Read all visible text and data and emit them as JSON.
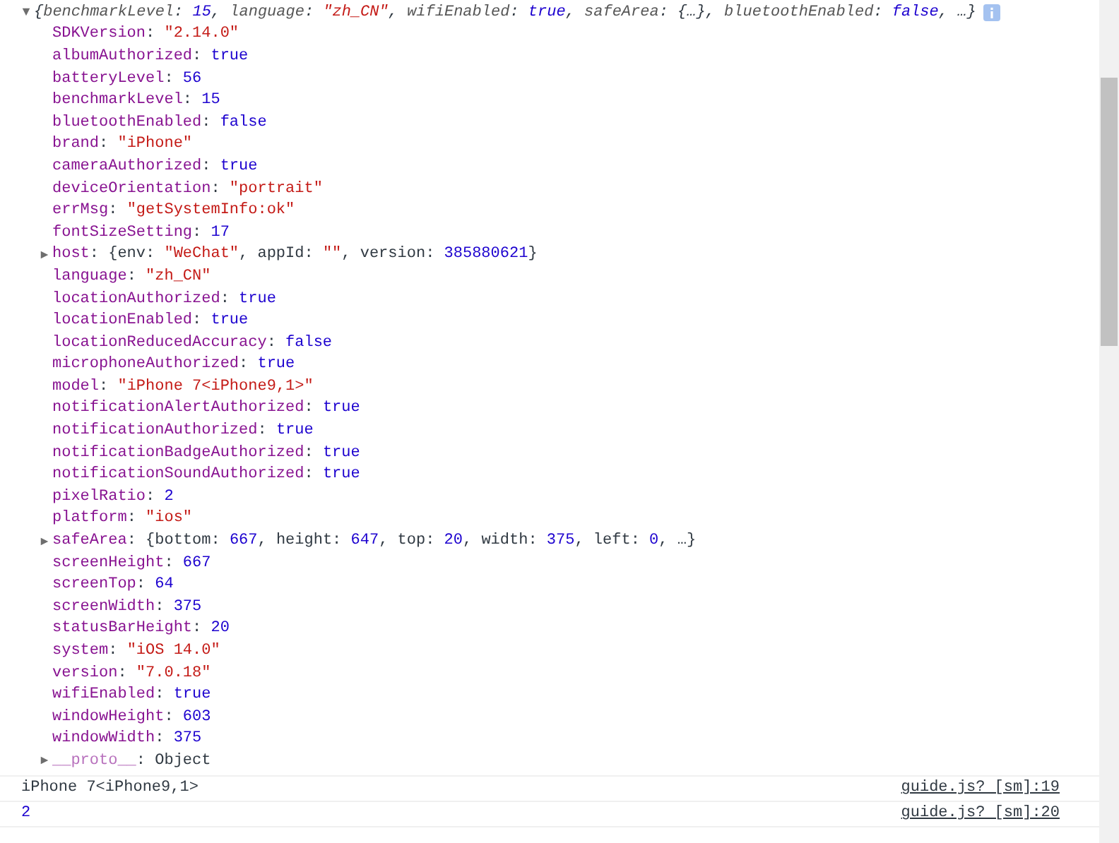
{
  "object_tree": {
    "expanded": true,
    "summary": [
      {
        "t": "{",
        "kind": "punct"
      },
      {
        "t": "benchmarkLevel",
        "kind": "key"
      },
      {
        "t": ": ",
        "kind": "punct"
      },
      {
        "t": "15",
        "kind": "number"
      },
      {
        "t": ", ",
        "kind": "punct"
      },
      {
        "t": "language",
        "kind": "key"
      },
      {
        "t": ": ",
        "kind": "punct"
      },
      {
        "t": "\"zh_CN\"",
        "kind": "string"
      },
      {
        "t": ", ",
        "kind": "punct"
      },
      {
        "t": "wifiEnabled",
        "kind": "key"
      },
      {
        "t": ": ",
        "kind": "punct"
      },
      {
        "t": "true",
        "kind": "number"
      },
      {
        "t": ", ",
        "kind": "punct"
      },
      {
        "t": "safeArea",
        "kind": "key"
      },
      {
        "t": ": {…}, ",
        "kind": "punct"
      },
      {
        "t": "bluetoothEnabled",
        "kind": "key"
      },
      {
        "t": ": ",
        "kind": "punct"
      },
      {
        "t": "false",
        "kind": "number"
      },
      {
        "t": ", …}",
        "kind": "punct"
      }
    ],
    "properties": [
      {
        "kind": "leaf",
        "tokens": [
          {
            "t": "SDKVersion",
            "kind": "key"
          },
          {
            "t": ": ",
            "kind": "punct"
          },
          {
            "t": "\"2.14.0\"",
            "kind": "string"
          }
        ]
      },
      {
        "kind": "leaf",
        "tokens": [
          {
            "t": "albumAuthorized",
            "kind": "key"
          },
          {
            "t": ": ",
            "kind": "punct"
          },
          {
            "t": "true",
            "kind": "number"
          }
        ]
      },
      {
        "kind": "leaf",
        "tokens": [
          {
            "t": "batteryLevel",
            "kind": "key"
          },
          {
            "t": ": ",
            "kind": "punct"
          },
          {
            "t": "56",
            "kind": "number"
          }
        ]
      },
      {
        "kind": "leaf",
        "tokens": [
          {
            "t": "benchmarkLevel",
            "kind": "key"
          },
          {
            "t": ": ",
            "kind": "punct"
          },
          {
            "t": "15",
            "kind": "number"
          }
        ]
      },
      {
        "kind": "leaf",
        "tokens": [
          {
            "t": "bluetoothEnabled",
            "kind": "key"
          },
          {
            "t": ": ",
            "kind": "punct"
          },
          {
            "t": "false",
            "kind": "number"
          }
        ]
      },
      {
        "kind": "leaf",
        "tokens": [
          {
            "t": "brand",
            "kind": "key"
          },
          {
            "t": ": ",
            "kind": "punct"
          },
          {
            "t": "\"iPhone\"",
            "kind": "string"
          }
        ]
      },
      {
        "kind": "leaf",
        "tokens": [
          {
            "t": "cameraAuthorized",
            "kind": "key"
          },
          {
            "t": ": ",
            "kind": "punct"
          },
          {
            "t": "true",
            "kind": "number"
          }
        ]
      },
      {
        "kind": "leaf",
        "tokens": [
          {
            "t": "deviceOrientation",
            "kind": "key"
          },
          {
            "t": ": ",
            "kind": "punct"
          },
          {
            "t": "\"portrait\"",
            "kind": "string"
          }
        ]
      },
      {
        "kind": "leaf",
        "tokens": [
          {
            "t": "errMsg",
            "kind": "key"
          },
          {
            "t": ": ",
            "kind": "punct"
          },
          {
            "t": "\"getSystemInfo:ok\"",
            "kind": "string"
          }
        ]
      },
      {
        "kind": "leaf",
        "tokens": [
          {
            "t": "fontSizeSetting",
            "kind": "key"
          },
          {
            "t": ": ",
            "kind": "punct"
          },
          {
            "t": "17",
            "kind": "number"
          }
        ]
      },
      {
        "kind": "toggle",
        "expanded": false,
        "tokens": [
          {
            "t": "host",
            "kind": "key"
          },
          {
            "t": ": {env: ",
            "kind": "punct"
          },
          {
            "t": "\"WeChat\"",
            "kind": "string"
          },
          {
            "t": ", appId: ",
            "kind": "punct"
          },
          {
            "t": "\"\"",
            "kind": "string"
          },
          {
            "t": ", version: ",
            "kind": "punct"
          },
          {
            "t": "385880621",
            "kind": "number"
          },
          {
            "t": "}",
            "kind": "punct"
          }
        ]
      },
      {
        "kind": "leaf",
        "tokens": [
          {
            "t": "language",
            "kind": "key"
          },
          {
            "t": ": ",
            "kind": "punct"
          },
          {
            "t": "\"zh_CN\"",
            "kind": "string"
          }
        ]
      },
      {
        "kind": "leaf",
        "tokens": [
          {
            "t": "locationAuthorized",
            "kind": "key"
          },
          {
            "t": ": ",
            "kind": "punct"
          },
          {
            "t": "true",
            "kind": "number"
          }
        ]
      },
      {
        "kind": "leaf",
        "tokens": [
          {
            "t": "locationEnabled",
            "kind": "key"
          },
          {
            "t": ": ",
            "kind": "punct"
          },
          {
            "t": "true",
            "kind": "number"
          }
        ]
      },
      {
        "kind": "leaf",
        "tokens": [
          {
            "t": "locationReducedAccuracy",
            "kind": "key"
          },
          {
            "t": ": ",
            "kind": "punct"
          },
          {
            "t": "false",
            "kind": "number"
          }
        ]
      },
      {
        "kind": "leaf",
        "tokens": [
          {
            "t": "microphoneAuthorized",
            "kind": "key"
          },
          {
            "t": ": ",
            "kind": "punct"
          },
          {
            "t": "true",
            "kind": "number"
          }
        ]
      },
      {
        "kind": "leaf",
        "tokens": [
          {
            "t": "model",
            "kind": "key"
          },
          {
            "t": ": ",
            "kind": "punct"
          },
          {
            "t": "\"iPhone 7<iPhone9,1>\"",
            "kind": "string"
          }
        ]
      },
      {
        "kind": "leaf",
        "tokens": [
          {
            "t": "notificationAlertAuthorized",
            "kind": "key"
          },
          {
            "t": ": ",
            "kind": "punct"
          },
          {
            "t": "true",
            "kind": "number"
          }
        ]
      },
      {
        "kind": "leaf",
        "tokens": [
          {
            "t": "notificationAuthorized",
            "kind": "key"
          },
          {
            "t": ": ",
            "kind": "punct"
          },
          {
            "t": "true",
            "kind": "number"
          }
        ]
      },
      {
        "kind": "leaf",
        "tokens": [
          {
            "t": "notificationBadgeAuthorized",
            "kind": "key"
          },
          {
            "t": ": ",
            "kind": "punct"
          },
          {
            "t": "true",
            "kind": "number"
          }
        ]
      },
      {
        "kind": "leaf",
        "tokens": [
          {
            "t": "notificationSoundAuthorized",
            "kind": "key"
          },
          {
            "t": ": ",
            "kind": "punct"
          },
          {
            "t": "true",
            "kind": "number"
          }
        ]
      },
      {
        "kind": "leaf",
        "tokens": [
          {
            "t": "pixelRatio",
            "kind": "key"
          },
          {
            "t": ": ",
            "kind": "punct"
          },
          {
            "t": "2",
            "kind": "number"
          }
        ]
      },
      {
        "kind": "leaf",
        "tokens": [
          {
            "t": "platform",
            "kind": "key"
          },
          {
            "t": ": ",
            "kind": "punct"
          },
          {
            "t": "\"ios\"",
            "kind": "string"
          }
        ]
      },
      {
        "kind": "toggle",
        "expanded": false,
        "tokens": [
          {
            "t": "safeArea",
            "kind": "key"
          },
          {
            "t": ": {bottom: ",
            "kind": "punct"
          },
          {
            "t": "667",
            "kind": "number"
          },
          {
            "t": ", height: ",
            "kind": "punct"
          },
          {
            "t": "647",
            "kind": "number"
          },
          {
            "t": ", top: ",
            "kind": "punct"
          },
          {
            "t": "20",
            "kind": "number"
          },
          {
            "t": ", width: ",
            "kind": "punct"
          },
          {
            "t": "375",
            "kind": "number"
          },
          {
            "t": ", left: ",
            "kind": "punct"
          },
          {
            "t": "0",
            "kind": "number"
          },
          {
            "t": ", …}",
            "kind": "punct"
          }
        ]
      },
      {
        "kind": "leaf",
        "tokens": [
          {
            "t": "screenHeight",
            "kind": "key"
          },
          {
            "t": ": ",
            "kind": "punct"
          },
          {
            "t": "667",
            "kind": "number"
          }
        ]
      },
      {
        "kind": "leaf",
        "tokens": [
          {
            "t": "screenTop",
            "kind": "key"
          },
          {
            "t": ": ",
            "kind": "punct"
          },
          {
            "t": "64",
            "kind": "number"
          }
        ]
      },
      {
        "kind": "leaf",
        "tokens": [
          {
            "t": "screenWidth",
            "kind": "key"
          },
          {
            "t": ": ",
            "kind": "punct"
          },
          {
            "t": "375",
            "kind": "number"
          }
        ]
      },
      {
        "kind": "leaf",
        "tokens": [
          {
            "t": "statusBarHeight",
            "kind": "key"
          },
          {
            "t": ": ",
            "kind": "punct"
          },
          {
            "t": "20",
            "kind": "number"
          }
        ]
      },
      {
        "kind": "leaf",
        "tokens": [
          {
            "t": "system",
            "kind": "key"
          },
          {
            "t": ": ",
            "kind": "punct"
          },
          {
            "t": "\"iOS 14.0\"",
            "kind": "string"
          }
        ]
      },
      {
        "kind": "leaf",
        "tokens": [
          {
            "t": "version",
            "kind": "key"
          },
          {
            "t": ": ",
            "kind": "punct"
          },
          {
            "t": "\"7.0.18\"",
            "kind": "string"
          }
        ]
      },
      {
        "kind": "leaf",
        "tokens": [
          {
            "t": "wifiEnabled",
            "kind": "key"
          },
          {
            "t": ": ",
            "kind": "punct"
          },
          {
            "t": "true",
            "kind": "number"
          }
        ]
      },
      {
        "kind": "leaf",
        "tokens": [
          {
            "t": "windowHeight",
            "kind": "key"
          },
          {
            "t": ": ",
            "kind": "punct"
          },
          {
            "t": "603",
            "kind": "number"
          }
        ]
      },
      {
        "kind": "leaf",
        "tokens": [
          {
            "t": "windowWidth",
            "kind": "key"
          },
          {
            "t": ": ",
            "kind": "punct"
          },
          {
            "t": "375",
            "kind": "number"
          }
        ]
      },
      {
        "kind": "toggle",
        "expanded": false,
        "tokens": [
          {
            "t": "__proto__",
            "kind": "dimkey"
          },
          {
            "t": ": Object",
            "kind": "punct"
          }
        ]
      }
    ]
  },
  "log_entries": [
    {
      "kind": "text",
      "message": "iPhone 7<iPhone9,1>",
      "source": "guide.js? [sm]:19"
    },
    {
      "kind": "number",
      "message": "2",
      "source": "guide.js? [sm]:20"
    }
  ]
}
